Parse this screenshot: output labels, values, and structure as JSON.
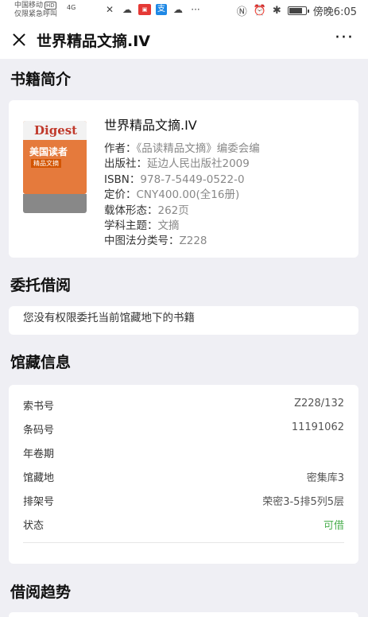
{
  "status_bar": {
    "carrier": "中国移动",
    "hd": "HD",
    "emergency": "仅限紧急呼叫",
    "network": "4G",
    "time": "傍晚6:05",
    "icons": [
      "signal-icon",
      "signal-x-icon",
      "muted-icon",
      "wechat-icon",
      "news-app-icon",
      "alipay-icon",
      "cloud-icon",
      "more-notifications-icon"
    ],
    "right_icons": [
      "nfc-icon",
      "alarm-icon",
      "bluetooth-icon",
      "battery-icon"
    ]
  },
  "navbar": {
    "title": "世界精品文摘.IV",
    "more": "···"
  },
  "sections": {
    "book_intro": "书籍简介",
    "delegate": "委托借阅",
    "holdings": "馆藏信息",
    "trend": "借阅趋势"
  },
  "book": {
    "title": "世界精品文摘.IV",
    "cover_text_en": "Digest",
    "cover_text_cn": "美国读者",
    "cover_text_sub": "精品文摘",
    "author_label": "作者：",
    "author": "《品读精品文摘》编委会编",
    "publisher_label": "出版社：",
    "publisher": "延边人民出版社2009",
    "isbn_label": "ISBN：",
    "isbn": "978-7-5449-0522-0",
    "price_label": "定价：",
    "price": "CNY400.00(全16册)",
    "form_label": "载体形态：",
    "form": "262页",
    "subject_label": "学科主题：",
    "subject": "文摘",
    "clc_label": "中图法分类号：",
    "clc": "Z228"
  },
  "delegate": {
    "message": "您没有权限委托当前馆藏地下的书籍"
  },
  "holdings": {
    "rows": [
      {
        "label": "索书号",
        "value": "Z228/132"
      },
      {
        "label": "条码号",
        "value": "11191062"
      },
      {
        "label": "年卷期",
        "value": ""
      },
      {
        "label": "馆藏地",
        "value": "密集库3"
      },
      {
        "label": "排架号",
        "value": "荣密3-5排5列5层"
      },
      {
        "label": "状态",
        "value": "可借"
      }
    ],
    "status_color": "#4caf50"
  }
}
